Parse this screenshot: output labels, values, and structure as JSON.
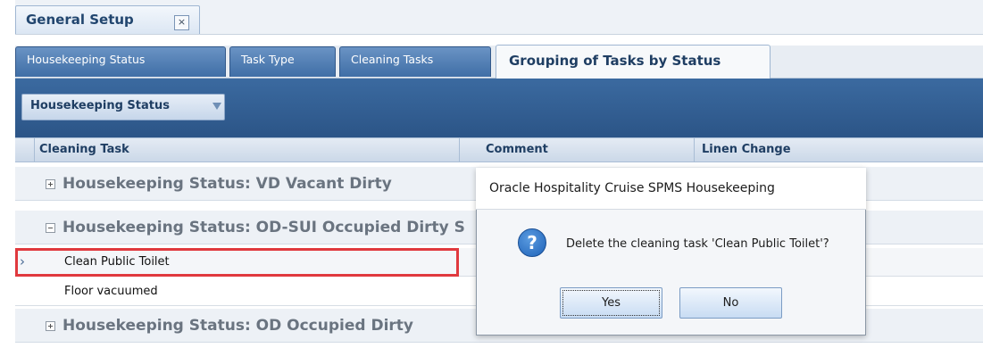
{
  "document_tab": {
    "title": "General Setup",
    "close": "×"
  },
  "sub_tabs": [
    {
      "label": "Housekeeping Status"
    },
    {
      "label": "Task Type"
    },
    {
      "label": "Cleaning Tasks"
    },
    {
      "label": "Grouping of Tasks by Status"
    }
  ],
  "group_by_chip": {
    "label": "Housekeeping Status",
    "arrow": "▼"
  },
  "grid": {
    "columns": [
      "Cleaning Task",
      "Comment",
      "Linen Change"
    ],
    "groups": [
      {
        "label": "Housekeeping Status: VD Vacant Dirty",
        "expanded": false
      },
      {
        "label": "Housekeeping Status: OD-SUI Occupied Dirty S",
        "expanded": true,
        "rows": [
          {
            "task": "Clean Public Toilet",
            "selected": true
          },
          {
            "task": "Floor vacuumed",
            "selected": false
          }
        ]
      },
      {
        "label": "Housekeeping Status: OD Occupied Dirty",
        "expanded": false
      }
    ],
    "row_indicator": "›"
  },
  "dialog": {
    "title": "Oracle Hospitality Cruise SPMS Housekeeping",
    "icon": "?",
    "message": "Delete the cleaning task 'Clean Public Toilet'?",
    "yes_label": "Yes",
    "no_label": "No"
  },
  "colors": {
    "highlight_border": "#e0393e",
    "tab_active_bg": "#4a78b0",
    "panel_bg": "#2f5a8f"
  }
}
